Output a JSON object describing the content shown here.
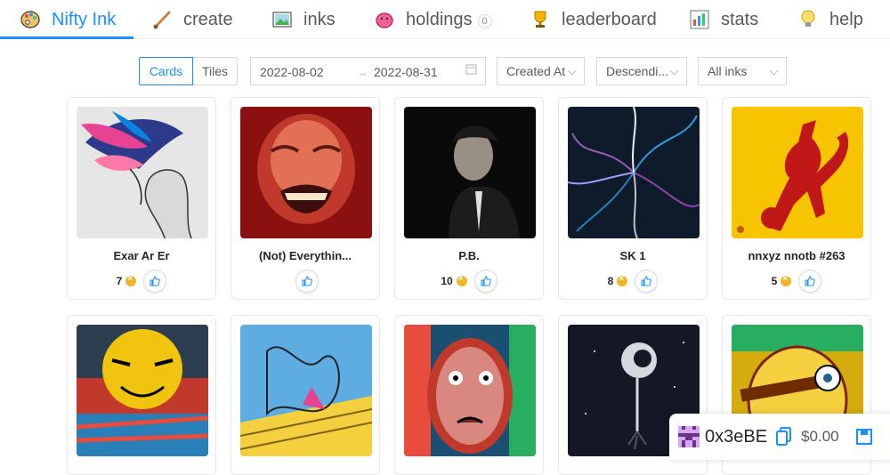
{
  "nav": {
    "items": [
      {
        "label": "Nifty Ink",
        "icon": "palette-icon"
      },
      {
        "label": "create",
        "icon": "brush-icon"
      },
      {
        "label": "inks",
        "icon": "picture-icon"
      },
      {
        "label": "holdings",
        "icon": "piggy-bank-icon",
        "badge": "0"
      },
      {
        "label": "leaderboard",
        "icon": "trophy-icon"
      },
      {
        "label": "stats",
        "icon": "bar-chart-icon"
      },
      {
        "label": "help",
        "icon": "lightbulb-icon"
      }
    ]
  },
  "filters": {
    "view_cards": "Cards",
    "view_tiles": "Tiles",
    "date_start": "2022-08-02",
    "date_end": "2022-08-31",
    "sort_field": "Created At",
    "sort_order": "Descendi...",
    "ink_filter": "All inks"
  },
  "cards": [
    {
      "title": "Exar Ar Er",
      "likes": "7"
    },
    {
      "title": "(Not) Everythin...",
      "likes": ""
    },
    {
      "title": "P.B.",
      "likes": "10"
    },
    {
      "title": "SK 1",
      "likes": "8"
    },
    {
      "title": "nnxyz nnotb #263",
      "likes": "5"
    }
  ],
  "wallet": {
    "address": "0x3eBE",
    "balance": "$0.00"
  },
  "colors": {
    "accent": "#1890ff",
    "coin": "#f0b429"
  }
}
